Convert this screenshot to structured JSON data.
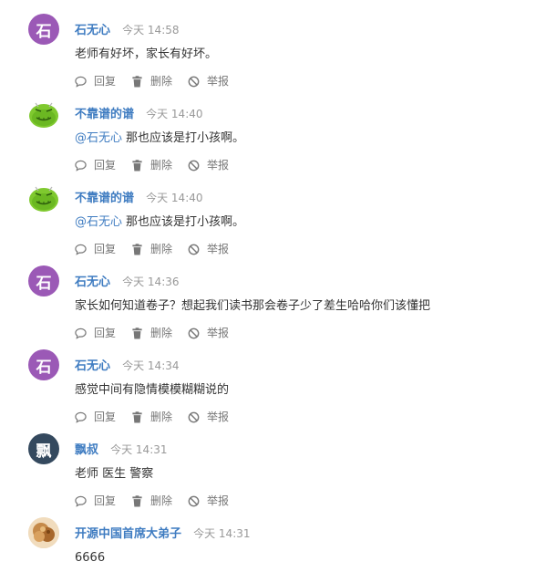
{
  "actions": {
    "reply": "回复",
    "delete": "删除",
    "report": "举报"
  },
  "comments": [
    {
      "avatar_letter": "石",
      "avatar_color": "#9b59b6",
      "author": "石无心",
      "time": "今天 14:58",
      "mention": "",
      "text": "老师有好坏，家长有好坏。"
    },
    {
      "avatar_letter": "",
      "avatar_color": "#7fc92f",
      "author": "不靠谱的谱",
      "time": "今天 14:40",
      "mention": "@石无心",
      "text": "那也应该是打小孩啊。"
    },
    {
      "avatar_letter": "",
      "avatar_color": "#7fc92f",
      "author": "不靠谱的谱",
      "time": "今天 14:40",
      "mention": "@石无心",
      "text": "那也应该是打小孩啊。"
    },
    {
      "avatar_letter": "石",
      "avatar_color": "#9b59b6",
      "author": "石无心",
      "time": "今天 14:36",
      "mention": "",
      "text": "家长如何知道卷子？想起我们读书那会卷子少了差生哈哈你们该懂把"
    },
    {
      "avatar_letter": "石",
      "avatar_color": "#9b59b6",
      "author": "石无心",
      "time": "今天 14:34",
      "mention": "",
      "text": "感觉中间有隐情模模糊糊说的"
    },
    {
      "avatar_letter": "飘",
      "avatar_color": "#34495e",
      "author": "飘叔",
      "time": "今天 14:31",
      "mention": "",
      "text": "老师 医生 警察"
    },
    {
      "avatar_letter": "",
      "avatar_color": "#c8955a",
      "author": "开源中国首席大弟子",
      "time": "今天 14:31",
      "mention": "",
      "text": "6666"
    }
  ],
  "colors": {
    "link": "#3f7cc1",
    "muted": "#999999",
    "text": "#333333",
    "purple_avatar": "#9b59b6",
    "dark_avatar": "#34495e",
    "green_avatar": "#7fc92f"
  },
  "icons": {
    "reply": "speech-bubble-icon",
    "delete": "trash-icon",
    "report": "prohibited-icon"
  }
}
